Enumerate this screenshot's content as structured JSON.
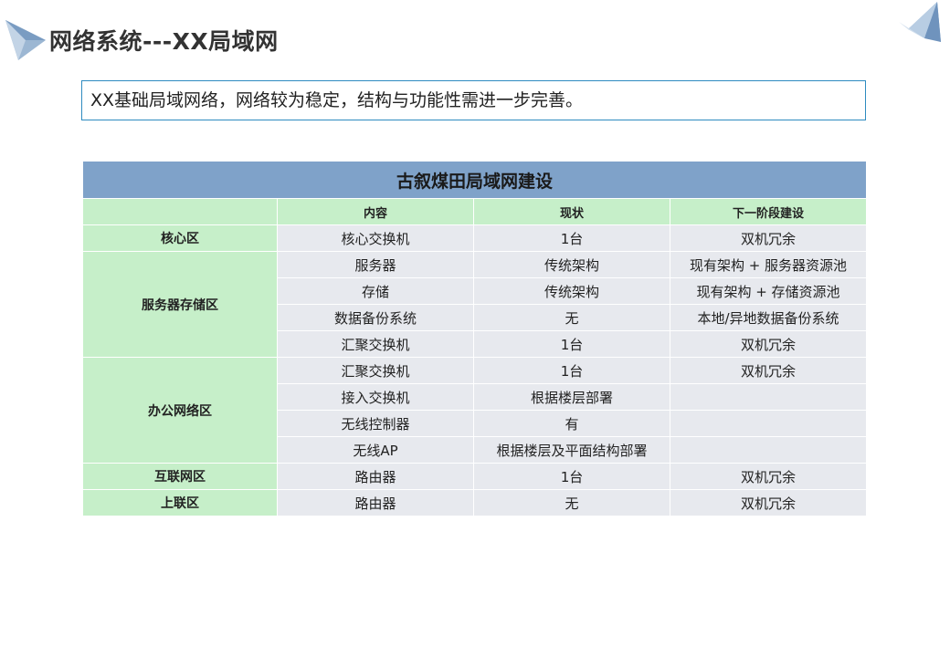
{
  "page": {
    "title": "网络系统---XX局域网",
    "summary": "XX基础局域网络，网络较为稳定，结构与功能性需进一步完善。"
  },
  "table": {
    "title": "古叙煤田局域网建设",
    "headers": [
      "",
      "内容",
      "现状",
      "下一阶段建设"
    ],
    "zones": [
      {
        "name": "核心区",
        "rows": [
          [
            "核心交换机",
            "1台",
            "双机冗余"
          ]
        ]
      },
      {
        "name": "服务器存储区",
        "rows": [
          [
            "服务器",
            "传统架构",
            "现有架构 + 服务器资源池"
          ],
          [
            "存储",
            "传统架构",
            "现有架构 + 存储资源池"
          ],
          [
            "数据备份系统",
            "无",
            "本地/异地数据备份系统"
          ],
          [
            "汇聚交换机",
            "1台",
            "双机冗余"
          ]
        ]
      },
      {
        "name": "办公网络区",
        "rows": [
          [
            "汇聚交换机",
            "1台",
            "双机冗余"
          ],
          [
            "接入交换机",
            "根据楼层部署",
            ""
          ],
          [
            "无线控制器",
            "有",
            ""
          ],
          [
            "无线AP",
            "根据楼层及平面结构部署",
            ""
          ]
        ]
      },
      {
        "name": "互联网区",
        "rows": [
          [
            "路由器",
            "1台",
            "双机冗余"
          ]
        ]
      },
      {
        "name": "上联区",
        "rows": [
          [
            "路由器",
            "无",
            "双机冗余"
          ]
        ]
      }
    ]
  },
  "colors": {
    "title_bar": "#7fa2c9",
    "header_green": "#c6efc9",
    "cell_gray": "#e7e9ee",
    "box_border": "#2e8bc0"
  },
  "icons": {
    "left": "paper-plane-icon",
    "right": "paper-plane-icon"
  }
}
